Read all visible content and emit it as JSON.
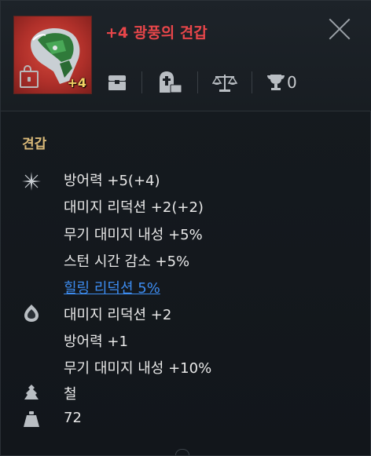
{
  "item": {
    "title": "+4 광풍의 견갑",
    "enhance_badge": "+4",
    "locked": false
  },
  "toolbar": {
    "trophy_count": "0"
  },
  "category": "견갑",
  "base_stats": [
    "방어력 +5(+4)",
    "대미지 리덕션 +2(+2)",
    "무기 대미지 내성 +5%",
    "스턴 시간 감소 +5%"
  ],
  "special_stat_link": "힐링 리덕션 5%",
  "option_stats": [
    "대미지 리덕션 +2",
    "방어력 +1",
    "무기 대미지 내성 +10%"
  ],
  "material": "철",
  "weight": "72",
  "colors": {
    "title": "#e8464a",
    "category": "#d9b978",
    "link": "#3d8cf0",
    "badge": "#f2d264"
  }
}
